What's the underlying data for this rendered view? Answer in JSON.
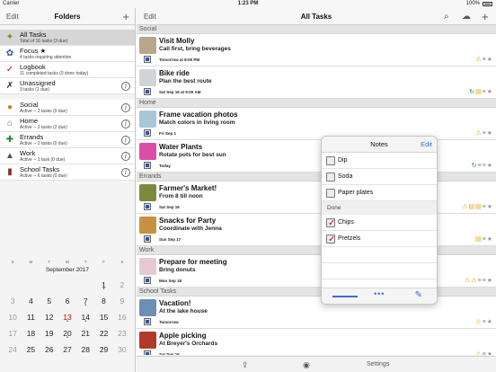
{
  "status": {
    "carrier": "Carrier",
    "time": "1:23 PM",
    "battery": "100%"
  },
  "left": {
    "edit_label": "Edit",
    "title": "Folders",
    "add_icon": "plus-icon",
    "folders": [
      {
        "name": "All Tasks",
        "sub": "Total of 16 tasks (3 due)",
        "icon": "all-tasks-icon",
        "selected": true
      },
      {
        "name": "Focus ★",
        "sub": "4 tasks requiring attention",
        "icon": "focus-icon"
      },
      {
        "name": "Logbook",
        "sub": "11 completed tasks (0 done today)",
        "icon": "logbook-icon"
      },
      {
        "name": "Unassigned",
        "sub": "3 tasks (1 due)",
        "icon": "unassigned-icon"
      },
      {
        "name": "Social",
        "sub": "Active -- 2 tasks (0 due)",
        "icon": "social-icon"
      },
      {
        "name": "Home",
        "sub": "Active -- 2 tasks (2 due)",
        "icon": "home-icon"
      },
      {
        "name": "Errands",
        "sub": "Active -- 2 tasks (0 due)",
        "icon": "errands-icon"
      },
      {
        "name": "Work",
        "sub": "Active -- 1 task (0 due)",
        "icon": "work-icon"
      },
      {
        "name": "School Tasks",
        "sub": "Active -- 6 tasks (0 due)",
        "icon": "school-icon"
      }
    ],
    "calendar": {
      "weekdays": [
        "S",
        "M",
        "T",
        "W",
        "T",
        "F",
        "S"
      ],
      "month": "September 2017",
      "weeks": [
        [
          "",
          "",
          "",
          "",
          "",
          "1",
          "2"
        ],
        [
          "3",
          "4",
          "5",
          "6",
          "7",
          "8",
          "9"
        ],
        [
          "10",
          "11",
          "12",
          "13",
          "14",
          "15",
          "16"
        ],
        [
          "17",
          "18",
          "19",
          "20",
          "21",
          "22",
          "23"
        ],
        [
          "24",
          "25",
          "26",
          "27",
          "28",
          "29",
          "30"
        ]
      ]
    }
  },
  "right": {
    "edit_label": "Edit",
    "title": "All Tasks",
    "sections": [
      {
        "name": "Social",
        "tasks": [
          {
            "title": "Visit Molly",
            "note": "Call first, bring beverages",
            "date": "Tomorrow at 8:00 PM",
            "thumb": "#b7a58c",
            "acts": [
              "warn",
              "menu",
              "star"
            ]
          },
          {
            "title": "Bike ride",
            "note": "Plan the best route",
            "date": "Sat Sep 16 at 9:00 AM",
            "thumb": "#cfd4d9",
            "acts": [
              "sync",
              "note",
              "menu",
              "star"
            ]
          }
        ]
      },
      {
        "name": "Home",
        "tasks": [
          {
            "title": "Frame vacation photos",
            "note": "Match colors in living room",
            "date": "Fri Sep 1",
            "thumb": "#a9c6d8",
            "acts": [
              "warn",
              "menu",
              "star"
            ]
          },
          {
            "title": "Water Plants",
            "note": "Rotate pots for best sun",
            "date": "Today",
            "thumb": "#d94fa6",
            "acts": [
              "sync",
              "flag",
              "menu",
              "star"
            ]
          }
        ]
      },
      {
        "name": "Errands",
        "tasks": [
          {
            "title": "Farmer's Market!",
            "note": "From 8 till noon",
            "date": "Sat Sep 16",
            "thumb": "#7b8a3e",
            "acts": [
              "warn",
              "note",
              "note",
              "menu",
              "star"
            ]
          },
          {
            "title": "Snacks for Party",
            "note": "Coordinate with Jenna",
            "date": "Sun Sep 17",
            "thumb": "#c8913f",
            "acts": [
              "note",
              "menu",
              "star"
            ]
          }
        ]
      },
      {
        "name": "Work",
        "tasks": [
          {
            "title": "Prepare for meeting",
            "note": "Bring donuts",
            "date": "Mon Sep 18",
            "thumb": "#e7c9d4",
            "acts": [
              "warn",
              "warn",
              "flag",
              "menu",
              "star"
            ]
          }
        ]
      },
      {
        "name": "School Tasks",
        "tasks": [
          {
            "title": "Vacation!",
            "note": "At the lake house",
            "date": "Tomorrow",
            "thumb": "#6b8fb5",
            "acts": [
              "warn",
              "menu",
              "star"
            ]
          },
          {
            "title": "Apple picking",
            "note": "At Breyer's Orchards",
            "date": "Sat Sep 16",
            "thumb": "#b23a2a",
            "acts": [
              "warn",
              "menu",
              "star"
            ]
          }
        ]
      }
    ],
    "toolbar": {
      "settings_label": "Settings"
    }
  },
  "notes": {
    "title": "Notes",
    "edit_label": "Edit",
    "open_items": [
      "Dip",
      "Soda",
      "Paper plates"
    ],
    "done_label": "Done",
    "done_items": [
      "Chips",
      "Pretzels"
    ]
  },
  "colors": {
    "accent": "#3b6fd1",
    "today": "#d0021b",
    "warning": "#e9a300",
    "sync": "#1a8f2b"
  }
}
